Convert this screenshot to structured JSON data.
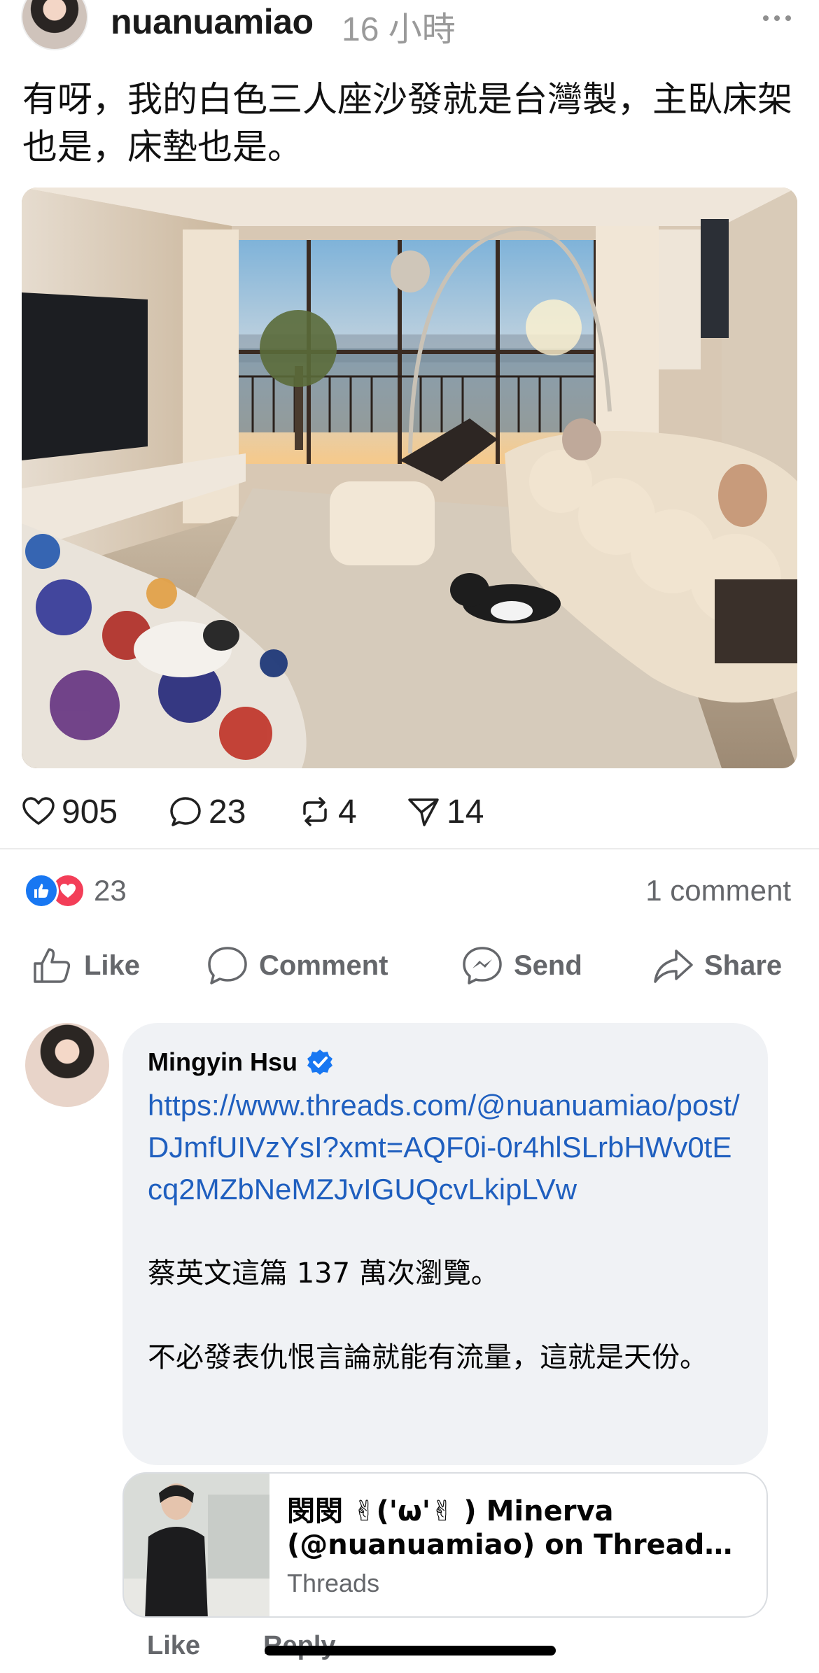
{
  "post": {
    "username": "nuanuamiao",
    "time": "16 小時",
    "more_icon": "ellipsis-icon",
    "text": "有呀，我的白色三人座沙發就是台灣製，主臥床架也是，床墊也是。",
    "stats": {
      "likes": "905",
      "comments": "23",
      "reposts": "4",
      "shares": "14"
    }
  },
  "facebook": {
    "reaction_count": "23",
    "comment_count": "1 comment",
    "actions": {
      "like": "Like",
      "comment": "Comment",
      "send": "Send",
      "share": "Share"
    },
    "comment": {
      "author": "Mingyin Hsu",
      "link": "https://www.threads.com/@nuanuamiao/post/DJmfUIVzYsI?xmt=AQF0i-0r4hlSLrbHWv0tEcq2MZbNeMZJvIGUQcvLkipLVw",
      "para1": "蔡英文這篇 137 萬次瀏覽。",
      "para2": "不必發表仇恨言論就能有流量，這就是天份。",
      "preview_title": "閔閔 ✌('ω'✌ ) Minerva (@nuanuamiao) on Threads • ...",
      "preview_source": "Threads",
      "footer_like": "Like",
      "footer_reply": "Reply"
    }
  },
  "colors": {
    "fb_blue": "#1877f2",
    "fb_love": "#f33e58",
    "link_blue": "#1f5fbf",
    "muted": "#65676b"
  }
}
